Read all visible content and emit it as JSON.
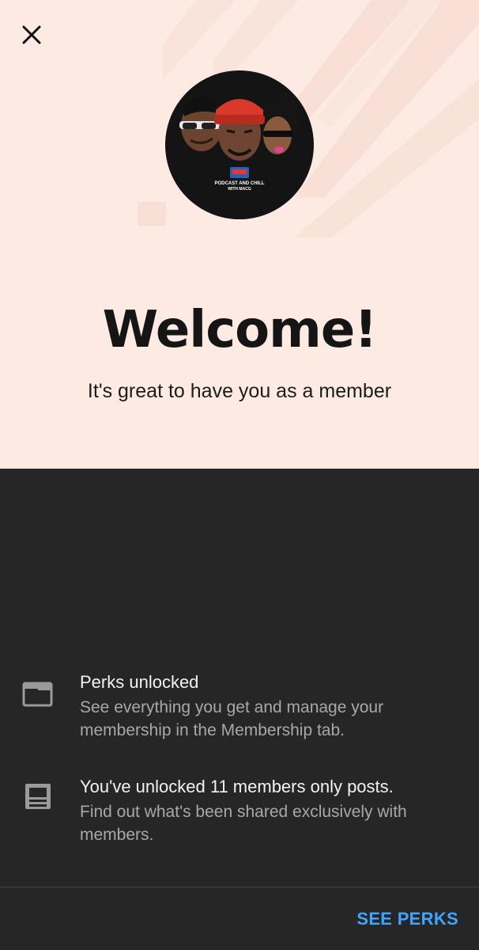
{
  "header": {
    "close_icon": "close-icon",
    "channel_logo": {
      "caption_line1": "PODCAST AND CHILL",
      "caption_line2": "WITH MACG"
    }
  },
  "welcome": {
    "title": "Welcome!",
    "subtitle": "It's great to have you as a member"
  },
  "perks": [
    {
      "icon": "membership-card-icon",
      "title": "Perks unlocked",
      "description": "See everything you get and manage your membership in the Membership tab."
    },
    {
      "icon": "posts-icon",
      "title": "You've unlocked 11 members only posts.",
      "description": "Find out what's been shared exclusively with members."
    }
  ],
  "footer": {
    "see_perks_label": "SEE PERKS"
  },
  "colors": {
    "hero_background": "#fdebe3",
    "panel_background": "#262626",
    "accent": "#3ea6ff"
  }
}
